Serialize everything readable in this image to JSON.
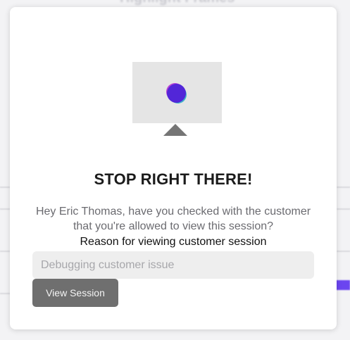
{
  "background": {
    "heading": "Highlight Frames"
  },
  "modal": {
    "title": "STOP RIGHT THERE!",
    "message": "Hey Eric Thomas, have you checked with the customer that you're allowed to view this session?",
    "reason_label": "Reason for viewing customer session",
    "reason_placeholder": "Debugging customer issue",
    "reason_value": "",
    "view_button_label": "View Session"
  },
  "illustration": {
    "screen_color": "#e5e5e5",
    "dot_color": "#5226d8",
    "stand_color": "#757575"
  },
  "colors": {
    "button": "#6f6f6f",
    "accent": "#6b45f0"
  }
}
